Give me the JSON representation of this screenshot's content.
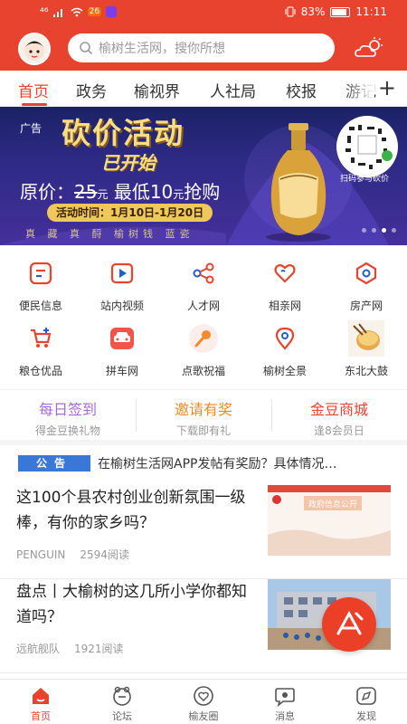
{
  "status_bar": {
    "signal": "⁴⁶",
    "badge": "26",
    "battery": "83%",
    "time": "11:11"
  },
  "header": {
    "search_placeholder": "榆树生活网，搜你所想"
  },
  "tabs": [
    {
      "label": "首页",
      "active": true
    },
    {
      "label": "政务"
    },
    {
      "label": "榆视界"
    },
    {
      "label": "人社局"
    },
    {
      "label": "校报"
    },
    {
      "label": "游记"
    }
  ],
  "banner": {
    "ad_label": "广告",
    "title": "砍价活动",
    "subtitle": "已开始",
    "price_prefix": "原价：",
    "price_original": "25",
    "price_unit": "元",
    "price_min": "最低10",
    "price_min_unit": "元",
    "price_suffix": "抢购",
    "date_range": "活动时间：1月10日-1月20日",
    "brand_line": "真 藏 真 酹  榆树钱 蓝瓷",
    "qr_caption": "扫码参与砍价"
  },
  "quick_links": [
    {
      "label": "便民信息",
      "icon": "info-card-icon"
    },
    {
      "label": "站内视频",
      "icon": "video-play-icon"
    },
    {
      "label": "人才网",
      "icon": "share-nodes-icon"
    },
    {
      "label": "相亲网",
      "icon": "heart-icon"
    },
    {
      "label": "房产网",
      "icon": "house-icon"
    },
    {
      "label": "粮仓优品",
      "icon": "shopping-cart-icon"
    },
    {
      "label": "拼车网",
      "icon": "car-icon"
    },
    {
      "label": "点歌祝福",
      "icon": "microphone-icon"
    },
    {
      "label": "榆树全景",
      "icon": "map-pin-icon"
    },
    {
      "label": "东北大鼓",
      "icon": "drum-icon"
    }
  ],
  "promos": [
    {
      "title": "每日签到",
      "subtitle": "得金豆换礼物",
      "color": "#a66ad6"
    },
    {
      "title": "邀请有奖",
      "subtitle": "下载即有礼",
      "color": "#f08a24"
    },
    {
      "title": "金豆商城",
      "subtitle": "逢8会员日",
      "color": "#e8432f"
    }
  ],
  "notice": {
    "tag": "公告",
    "text": "在榆树生活网APP发帖有奖励？具体情况…"
  },
  "news": [
    {
      "title": "这100个县农村创业创新氛围一级棒，有你的家乡吗？",
      "source": "PENGUIN",
      "reads": "2594阅读",
      "image_caption": "政府信息公开"
    },
    {
      "title": "盘点丨大榆树的这几所小学你都知道吗？",
      "source": "远航舰队",
      "reads": "1921阅读"
    }
  ],
  "bottom_nav": [
    {
      "label": "首页",
      "active": true
    },
    {
      "label": "论坛"
    },
    {
      "label": "榆友圈"
    },
    {
      "label": "消息"
    },
    {
      "label": "发现"
    }
  ],
  "colors": {
    "brand_red": "#e8432f",
    "notice_blue": "#3a78d8"
  }
}
